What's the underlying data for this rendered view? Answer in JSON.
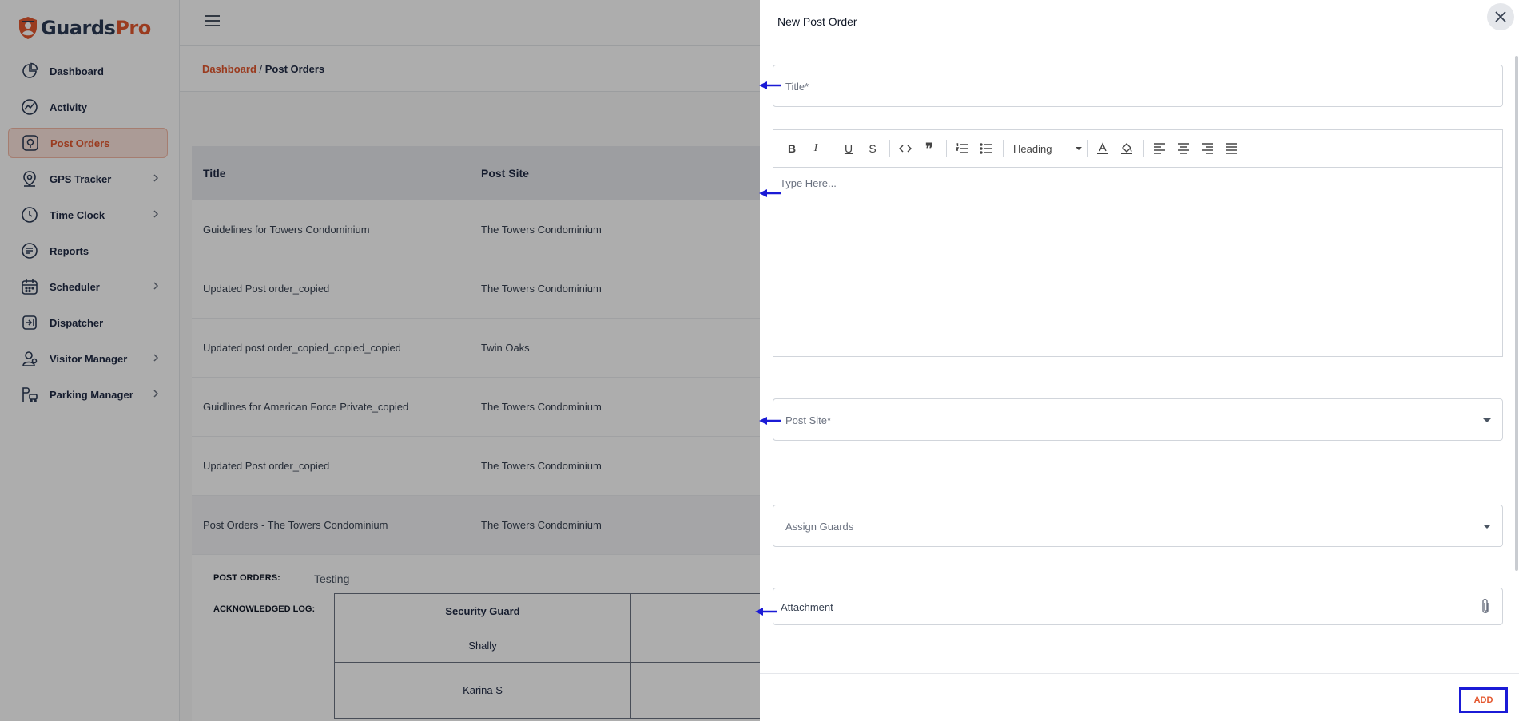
{
  "brand": {
    "name_part1": "Guards",
    "name_part2": "Pro",
    "accent": "#e4572e",
    "dark": "#2b3a55"
  },
  "sidebar": {
    "items": [
      {
        "label": "Dashboard",
        "icon": "dashboard-icon",
        "has_submenu": false
      },
      {
        "label": "Activity",
        "icon": "activity-icon",
        "has_submenu": false
      },
      {
        "label": "Post Orders",
        "icon": "post-orders-icon",
        "has_submenu": false,
        "active": true
      },
      {
        "label": "GPS Tracker",
        "icon": "location-pin-icon",
        "has_submenu": true
      },
      {
        "label": "Time Clock",
        "icon": "clock-icon",
        "has_submenu": true
      },
      {
        "label": "Reports",
        "icon": "reports-icon",
        "has_submenu": false
      },
      {
        "label": "Scheduler",
        "icon": "calendar-icon",
        "has_submenu": true
      },
      {
        "label": "Dispatcher",
        "icon": "dispatcher-icon",
        "has_submenu": false
      },
      {
        "label": "Visitor Manager",
        "icon": "visitor-icon",
        "has_submenu": true
      },
      {
        "label": "Parking Manager",
        "icon": "parking-icon",
        "has_submenu": true
      }
    ]
  },
  "breadcrumb": {
    "root": "Dashboard",
    "separator": " / ",
    "current": "Post Orders"
  },
  "table": {
    "headers": [
      "Title",
      "Post Site"
    ],
    "rows": [
      {
        "title": "Guidelines for Towers Condominium",
        "site": "The Towers Condominium"
      },
      {
        "title": "Updated Post order_copied",
        "site": "The Towers Condominium"
      },
      {
        "title": "Updated post order_copied_copied_copied",
        "site": "Twin Oaks"
      },
      {
        "title": "Guidlines for American Force Private_copied",
        "site": "The Towers Condominium"
      },
      {
        "title": "Updated Post order_copied",
        "site": "The Towers Condominium"
      },
      {
        "title": "Post Orders - The Towers Condominium",
        "site": "The Towers Condominium"
      }
    ]
  },
  "details": {
    "post_orders_label": "POST ORDERS:",
    "post_orders_value": "Testing",
    "log_label": "ACKNOWLEDGED LOG:",
    "log_header": "Security Guard",
    "log_rows": [
      "Shally",
      "Karina S"
    ]
  },
  "drawer": {
    "title": "New Post Order",
    "title_placeholder": "Title*",
    "editor_placeholder": "Type Here...",
    "heading_label": "Heading",
    "post_site_placeholder": "Post Site*",
    "assign_guards_placeholder": "Assign Guards",
    "attachment_label": "Attachment",
    "add_label": "ADD"
  }
}
